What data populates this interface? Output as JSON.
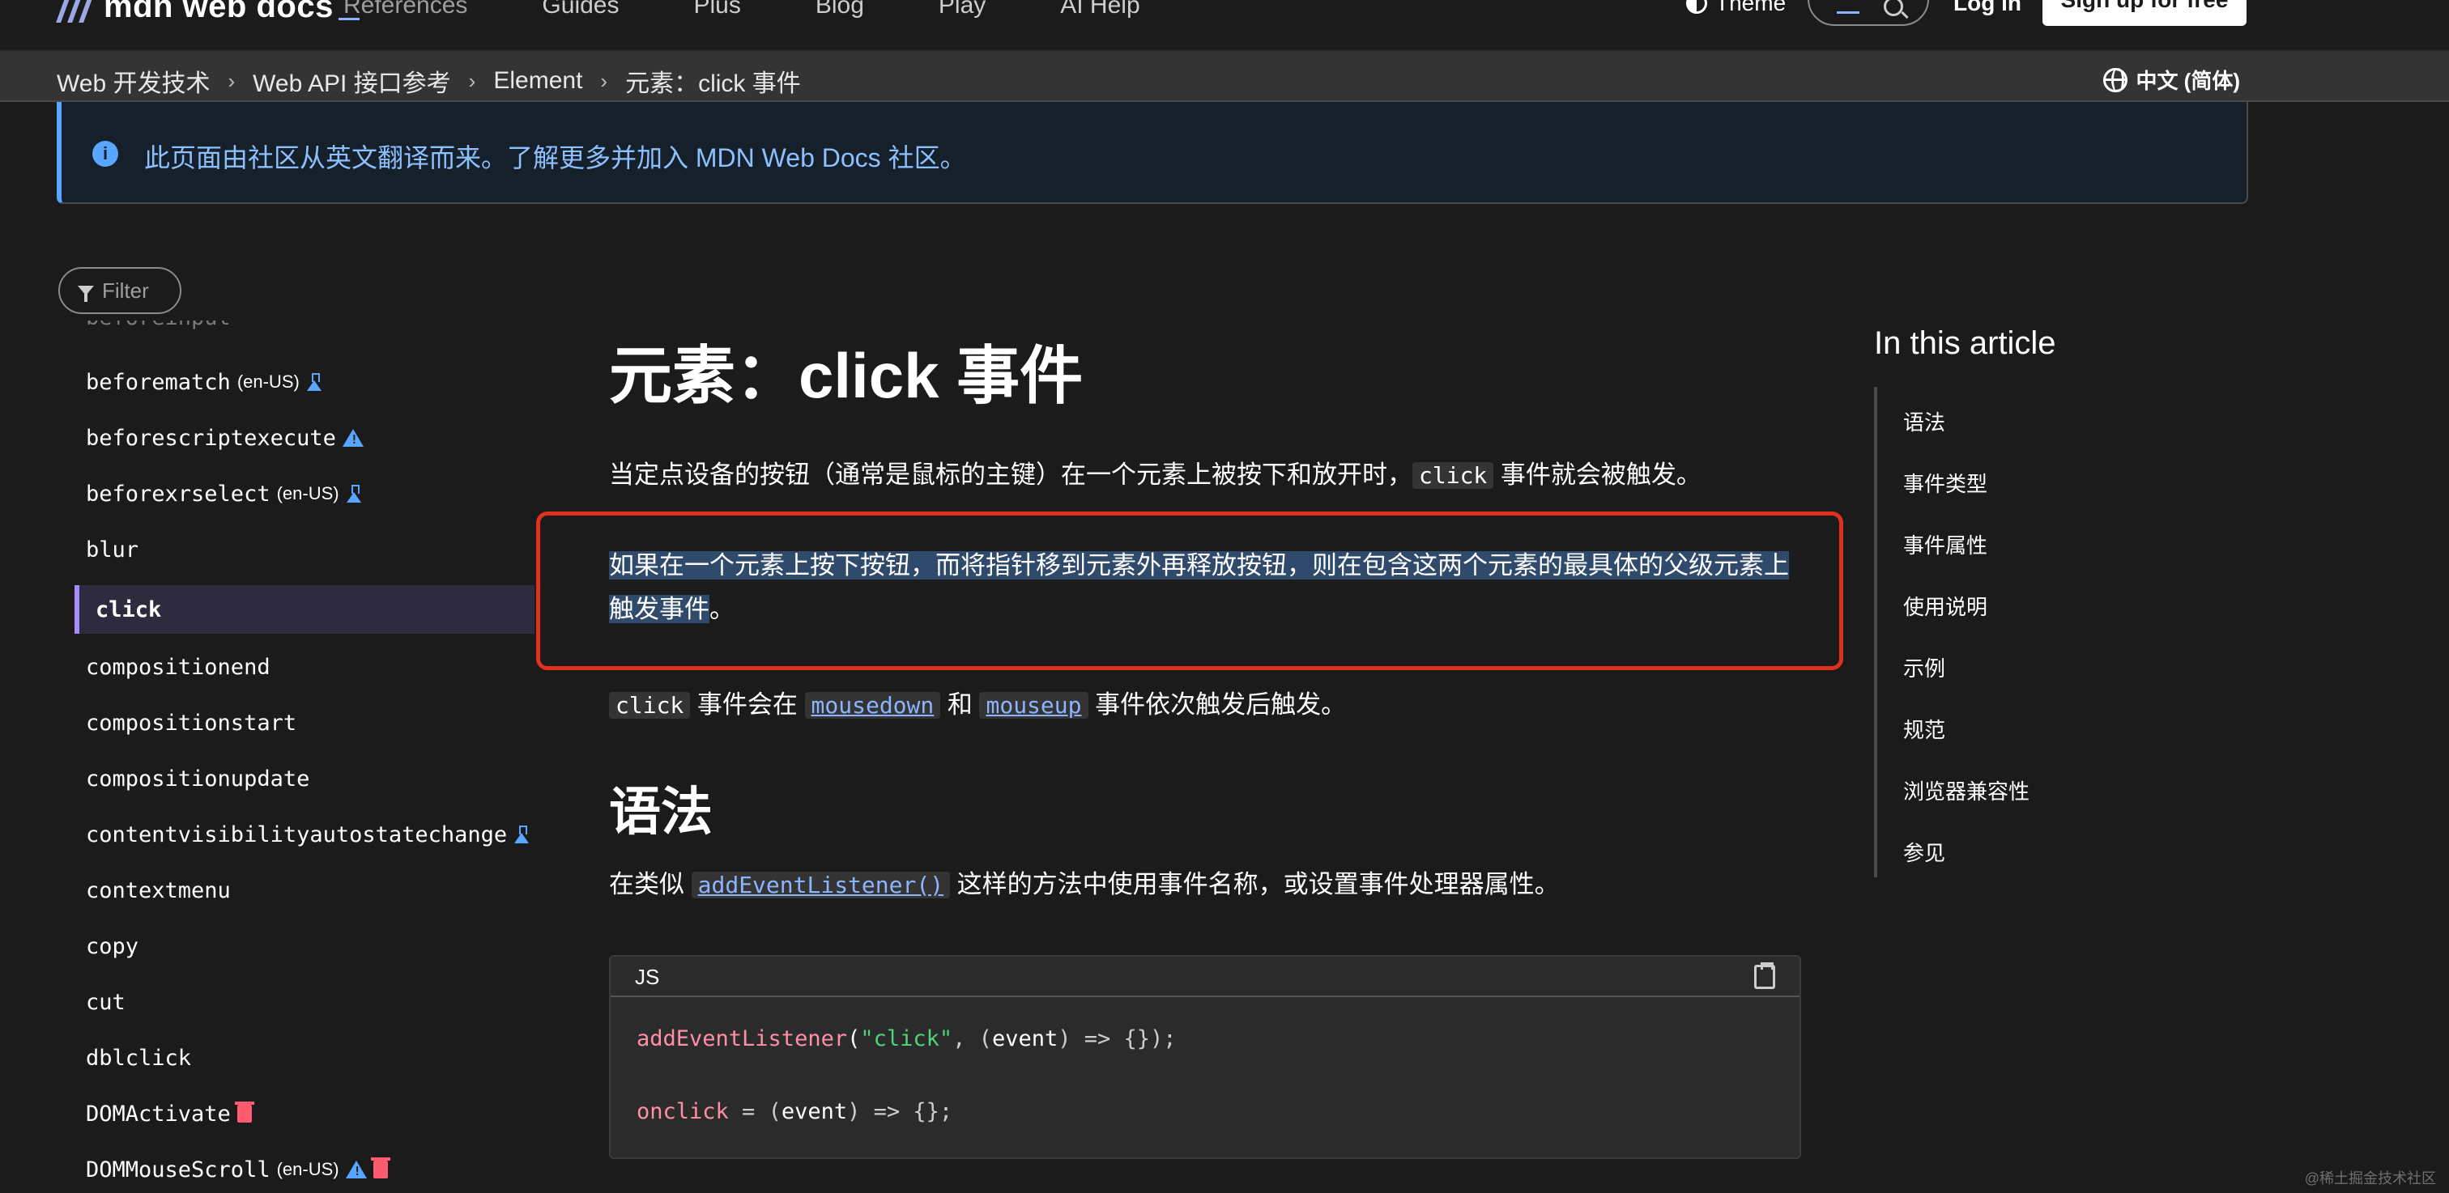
{
  "topnav": {
    "brand": "mdn web docs",
    "links": [
      "References",
      "Guides",
      "Plus",
      "Blog",
      "Play",
      "AI Help"
    ],
    "theme_label": "Theme",
    "login_label": "Log in",
    "signup_label": "Sign up for free"
  },
  "breadcrumb": {
    "items": [
      "Web 开发技术",
      "Web API 接口参考",
      "Element",
      "元素：click 事件"
    ],
    "language": "中文 (简体)"
  },
  "banner": {
    "message": "此页面由社区从英文翻译而来。了解更多并加入 MDN Web Docs 社区。"
  },
  "sidebar": {
    "filter_placeholder": "Filter",
    "items": [
      {
        "label": "beforematch",
        "tag": "(en-US)",
        "badges": [
          "flask-icon"
        ]
      },
      {
        "label": "beforescriptexecute",
        "tag": "",
        "badges": [
          "warning-icon"
        ]
      },
      {
        "label": "beforexrselect",
        "tag": "(en-US)",
        "badges": [
          "flask-icon"
        ]
      },
      {
        "label": "blur",
        "tag": "",
        "badges": []
      },
      {
        "label": "click",
        "tag": "",
        "badges": [],
        "active": true
      },
      {
        "label": "compositionend",
        "tag": "",
        "badges": []
      },
      {
        "label": "compositionstart",
        "tag": "",
        "badges": []
      },
      {
        "label": "compositionupdate",
        "tag": "",
        "badges": []
      },
      {
        "label": "contentvisibilityautostatechange",
        "tag": "",
        "badges": [
          "flask-icon"
        ]
      },
      {
        "label": "contextmenu",
        "tag": "",
        "badges": []
      },
      {
        "label": "copy",
        "tag": "",
        "badges": []
      },
      {
        "label": "cut",
        "tag": "",
        "badges": []
      },
      {
        "label": "dblclick",
        "tag": "",
        "badges": []
      },
      {
        "label": "DOMActivate",
        "tag": "",
        "badges": [
          "trash-icon"
        ]
      },
      {
        "label": "DOMMouseScroll",
        "tag": "(en-US)",
        "badges": [
          "warning-icon",
          "trash-icon"
        ]
      }
    ]
  },
  "article": {
    "title": "元素：click 事件",
    "intro_before": "当定点设备的按钮（通常是鼠标的主键）在一个元素上被按下和放开时，",
    "intro_code": "click",
    "intro_after": " 事件就会被触发。",
    "highlight_line1": "如果在一个元素上按下按钮，而将指针移到元素外再释放按钮，则在包含这两个元素的最具体的父级元素上",
    "highlight_line2_selected": "触发事件",
    "highlight_line2_rest": "。",
    "order_code": "click",
    "order_text1": " 事件会在 ",
    "order_link1": "mousedown",
    "order_text2": " 和 ",
    "order_link2": "mouseup",
    "order_text3": " 事件依次触发后触发。",
    "syntax_heading": "语法",
    "syntax_before": "在类似 ",
    "syntax_link": "addEventListener()",
    "syntax_after": " 这样的方法中使用事件名称，或设置事件处理器属性。",
    "code_lang": "JS",
    "code_line1_fn": "addEventListener",
    "code_line1_open": "(",
    "code_line1_str": "\"click\"",
    "code_line1_rest": ", (",
    "code_line1_param": "event",
    "code_line1_end": ") => {});",
    "code_line2_prop": "onclick",
    "code_line2_mid": " = (",
    "code_line2_param": "event",
    "code_line2_end": ") => {};"
  },
  "toc": {
    "title": "In this article",
    "items": [
      "语法",
      "事件类型",
      "事件属性",
      "使用说明",
      "示例",
      "规范",
      "浏览器兼容性",
      "参见"
    ]
  },
  "watermark": "@稀土掘金技术社区"
}
